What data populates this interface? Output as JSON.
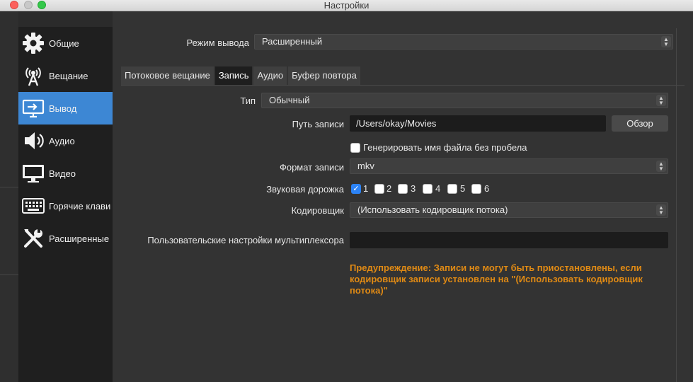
{
  "window": {
    "title": "Настройки"
  },
  "sidebar": {
    "items": [
      {
        "label": "Общие",
        "icon": "gear-icon"
      },
      {
        "label": "Вещание",
        "icon": "broadcast-antenna-icon"
      },
      {
        "label": "Вывод",
        "icon": "monitor-output-icon",
        "active": true
      },
      {
        "label": "Аудио",
        "icon": "speaker-icon"
      },
      {
        "label": "Видео",
        "icon": "display-icon"
      },
      {
        "label": "Горячие клави",
        "icon": "keyboard-icon"
      },
      {
        "label": "Расширенные",
        "icon": "tools-icon"
      }
    ]
  },
  "output_mode": {
    "label": "Режим вывода",
    "value": "Расширенный"
  },
  "tabs": [
    {
      "label": "Потоковое вещание"
    },
    {
      "label": "Запись",
      "active": true
    },
    {
      "label": "Аудио"
    },
    {
      "label": "Буфер повтора"
    }
  ],
  "recording": {
    "type": {
      "label": "Тип",
      "value": "Обычный"
    },
    "path": {
      "label": "Путь записи",
      "value": "/Users/okay/Movies",
      "browse_label": "Обзор"
    },
    "no_space": {
      "label": "Генерировать имя файла без пробела",
      "checked": false
    },
    "format": {
      "label": "Формат записи",
      "value": "mkv"
    },
    "audio_track": {
      "label": "Звуковая дорожка",
      "tracks": [
        {
          "label": "1",
          "checked": true
        },
        {
          "label": "2",
          "checked": false
        },
        {
          "label": "3",
          "checked": false
        },
        {
          "label": "4",
          "checked": false
        },
        {
          "label": "5",
          "checked": false
        },
        {
          "label": "6",
          "checked": false
        }
      ]
    },
    "encoder": {
      "label": "Кодировщик",
      "value": "(Использовать кодировщик потока)"
    },
    "muxer": {
      "label": "Пользовательские настройки мультиплексора",
      "value": ""
    },
    "warning": "Предупреждение: Записи не могут быть приостановлены, если кодировщик записи установлен на \"(Использовать кодировщик потока)\""
  },
  "colors": {
    "accent": "#3d87d4",
    "warning": "#e08a14",
    "checkbox": "#2c83f6"
  }
}
